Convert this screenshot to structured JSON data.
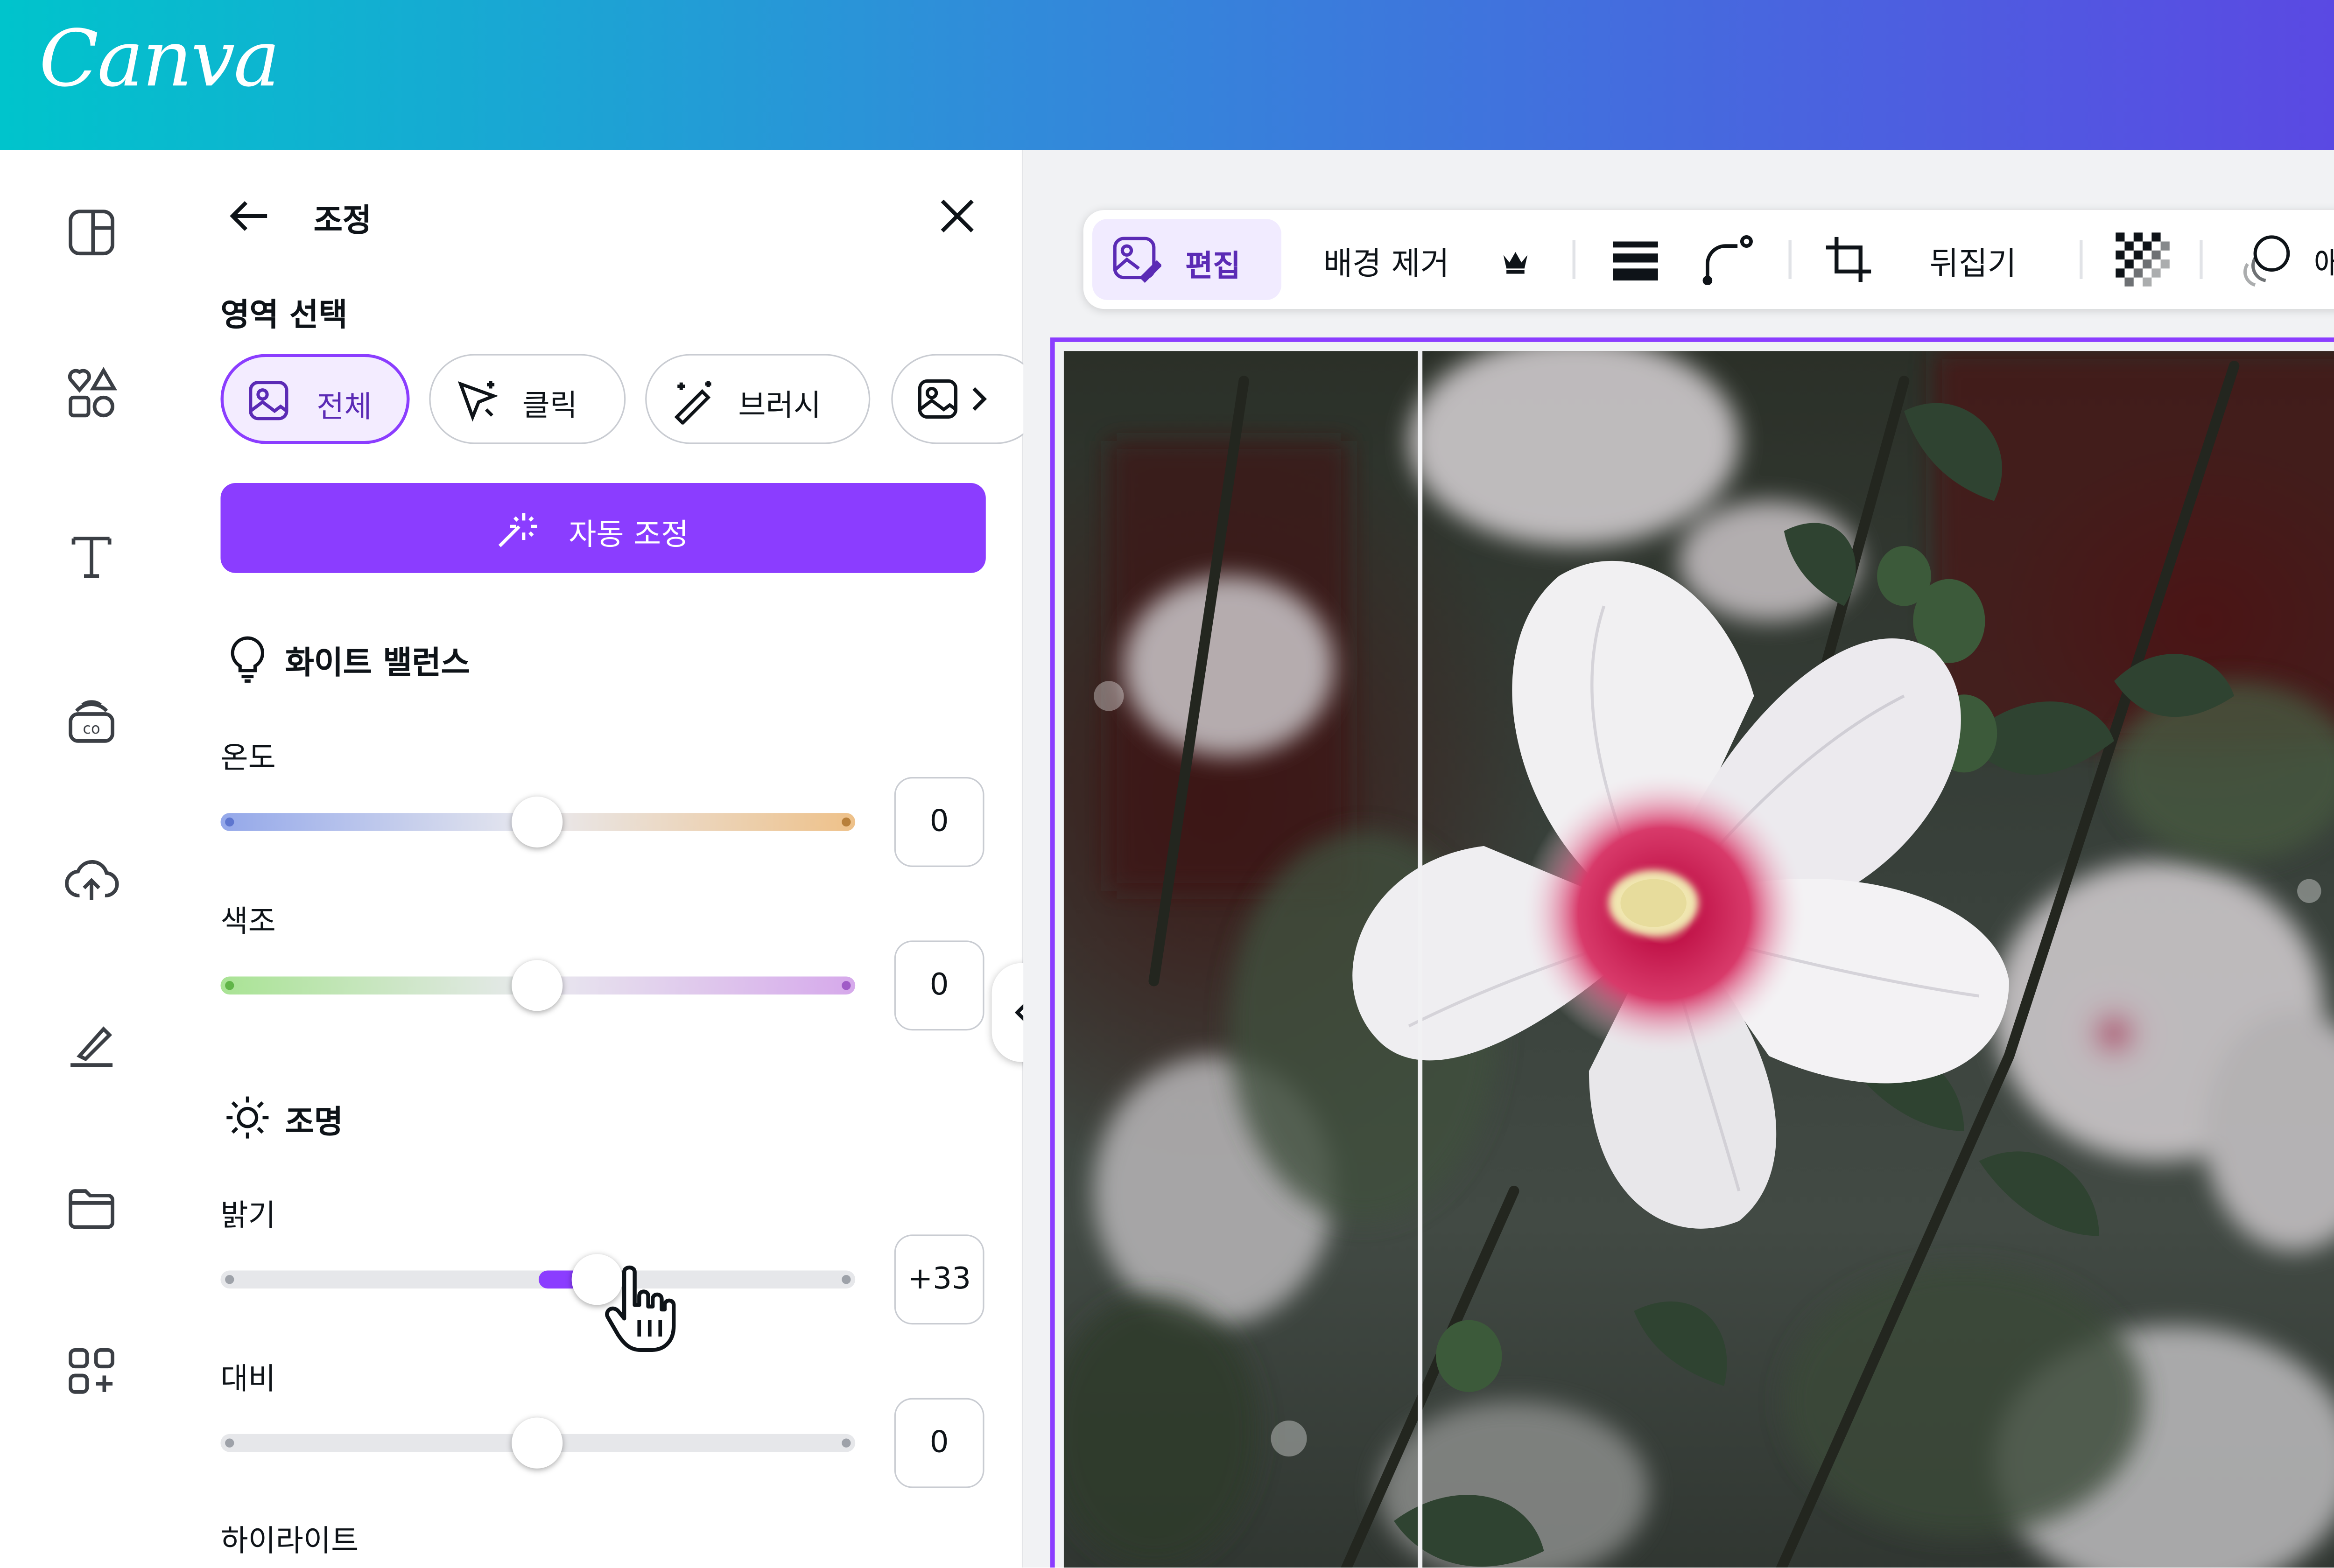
{
  "app": {
    "logo": "Canva"
  },
  "rail": {
    "items": [
      {
        "icon": "layout-icon"
      },
      {
        "icon": "elements-icon"
      },
      {
        "icon": "text-icon"
      },
      {
        "icon": "brand-icon"
      },
      {
        "icon": "upload-cloud-icon"
      },
      {
        "icon": "draw-icon"
      },
      {
        "icon": "projects-folder-icon"
      },
      {
        "icon": "apps-icon"
      }
    ]
  },
  "panel": {
    "title": "조정",
    "area_select_label": "영역 선택",
    "area_chips": [
      {
        "label": "전체",
        "active": true
      },
      {
        "label": "클릭",
        "active": false
      },
      {
        "label": "브러시",
        "active": false
      }
    ],
    "auto_adjust_label": "자동 조정",
    "white_balance": {
      "heading": "화이트 밸런스",
      "temperature": {
        "label": "온도",
        "value": "0",
        "level": 0
      },
      "tint": {
        "label": "색조",
        "value": "0",
        "level": 0
      }
    },
    "lighting": {
      "heading": "조명",
      "brightness": {
        "label": "밝기",
        "value": "+33",
        "level": 33
      },
      "contrast": {
        "label": "대비",
        "value": "0",
        "level": 0
      },
      "highlights": {
        "label": "하이라이트"
      }
    }
  },
  "toolbar": {
    "edit_label": "편집",
    "remove_bg_label": "배경 제거",
    "flip_label": "뒤집기",
    "animate_label": "애"
  },
  "colors": {
    "accent": "#8b3dff",
    "gradient_start": "#00c4cc",
    "gradient_end": "#5b48e3"
  }
}
